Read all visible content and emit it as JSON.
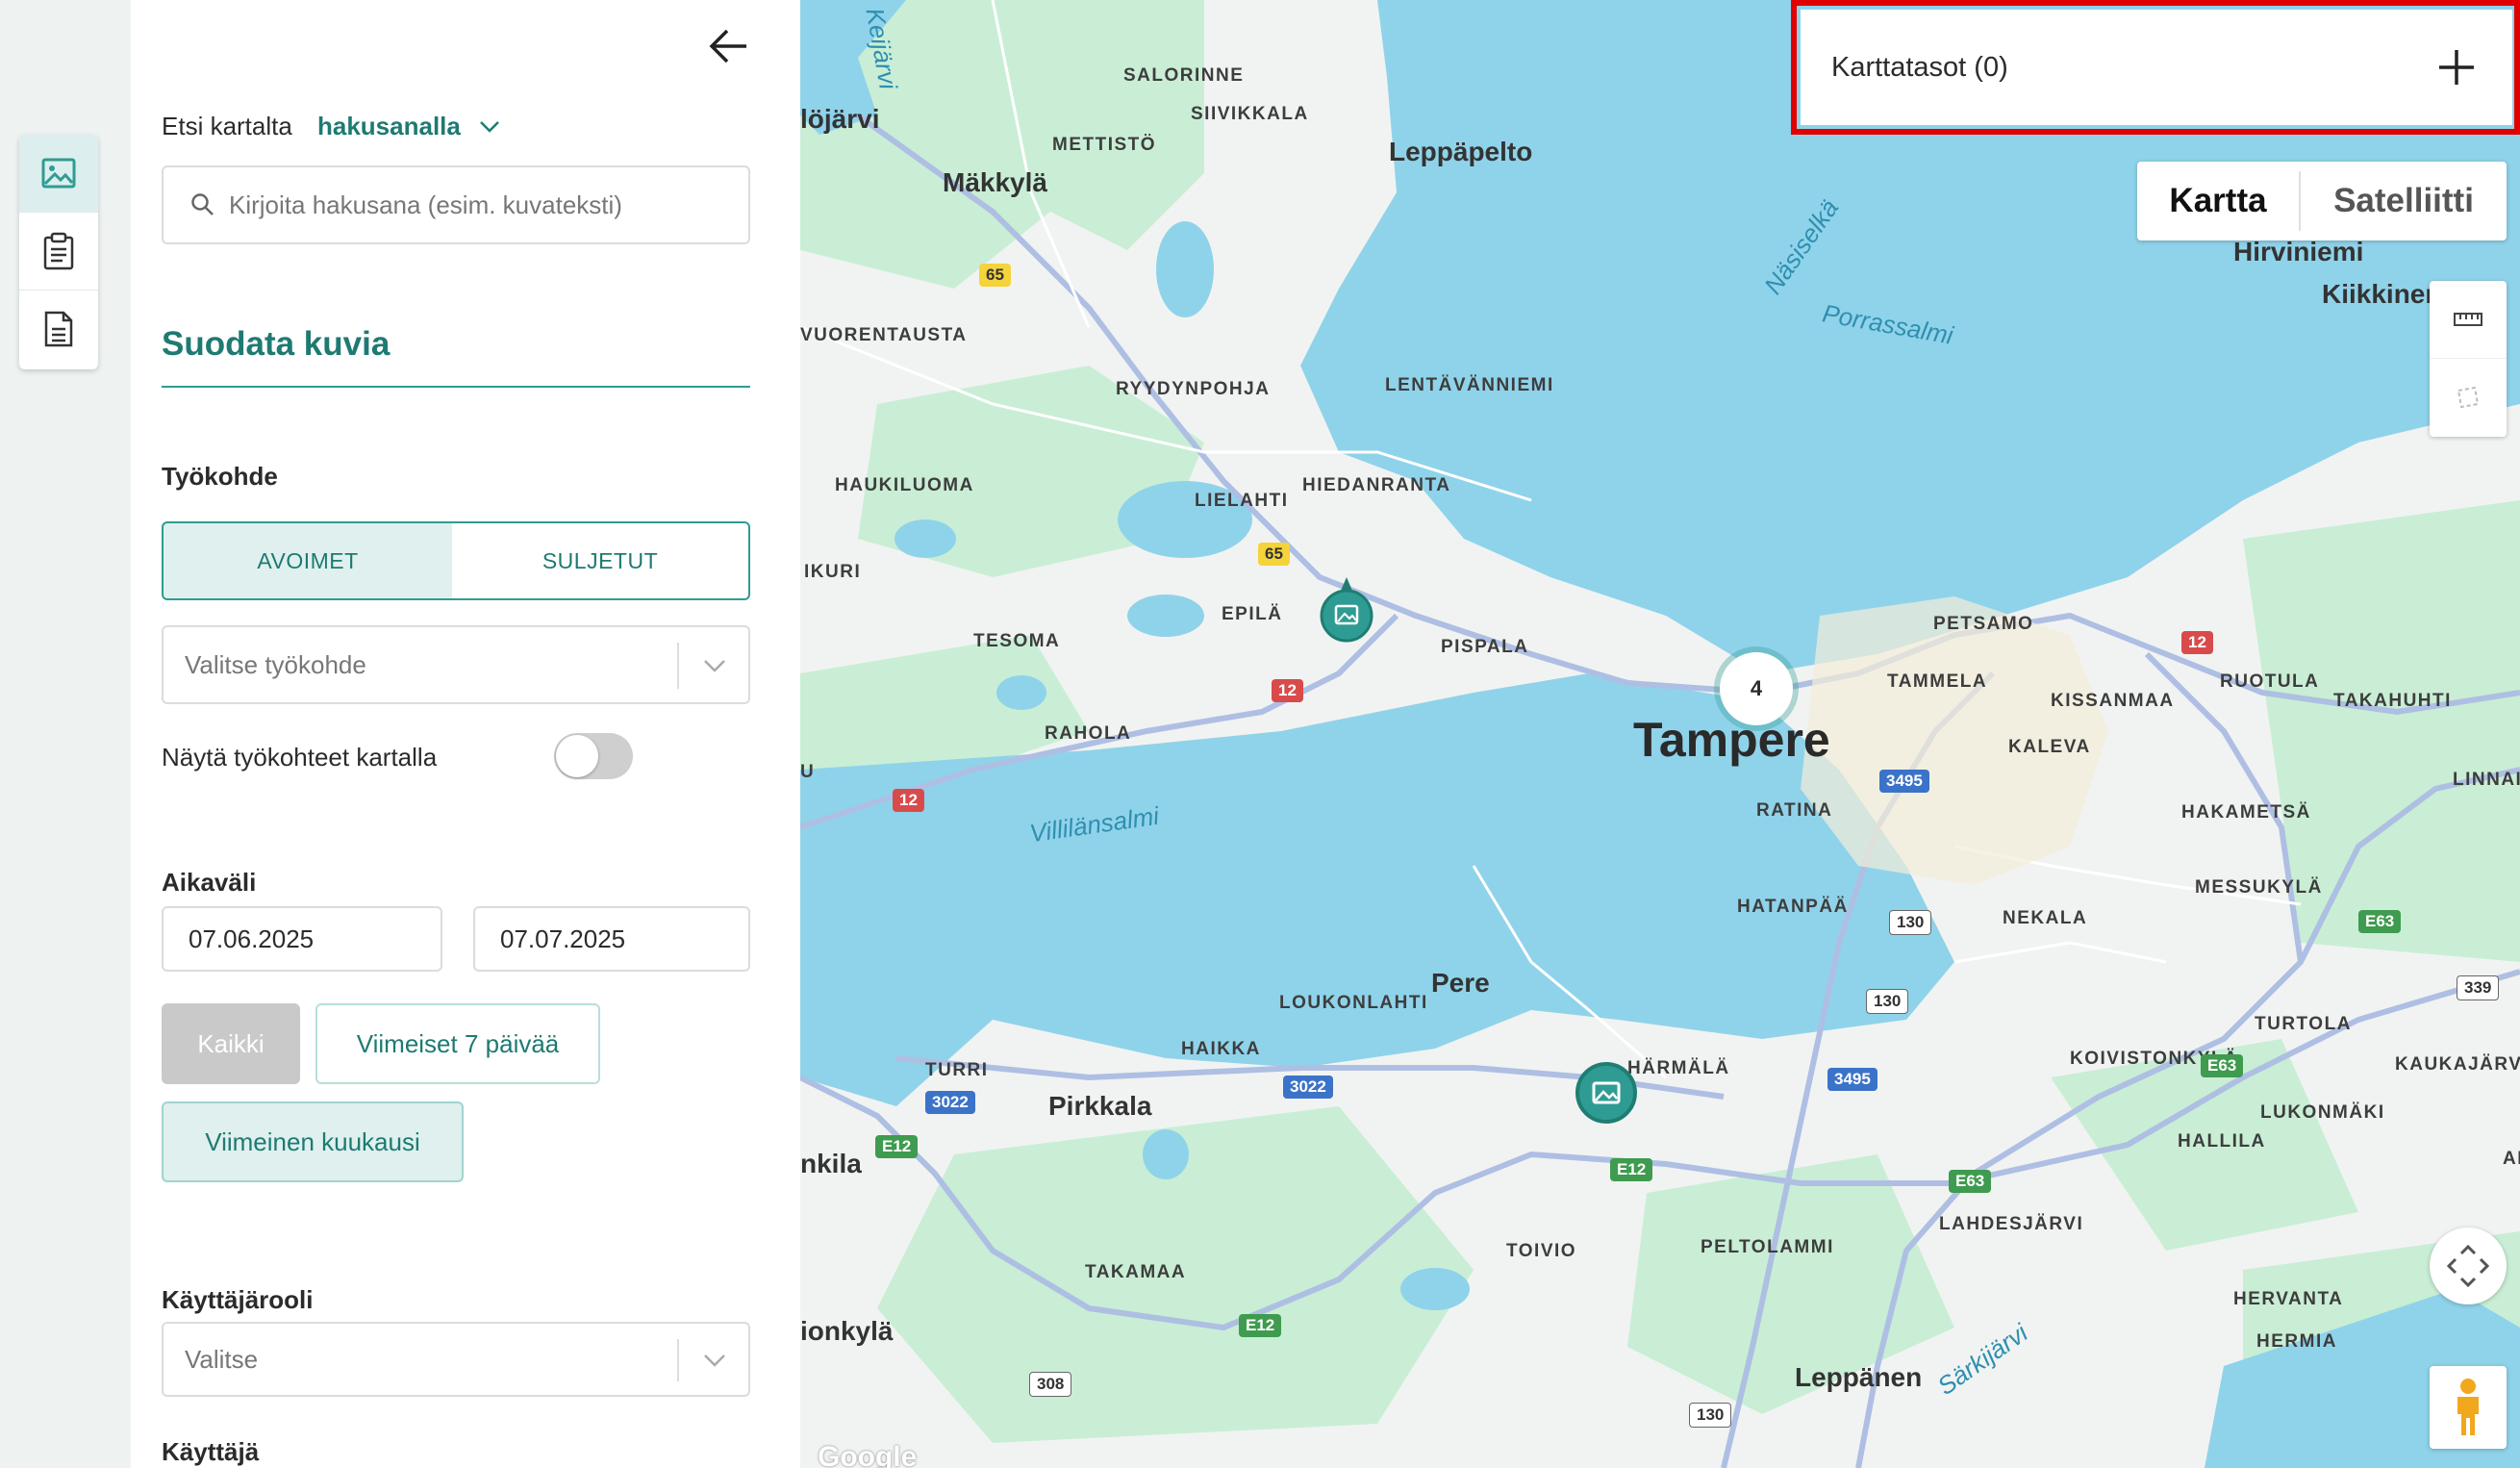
{
  "sidebar_icons": [
    "image-icon",
    "clipboard-icon",
    "document-icon"
  ],
  "panel": {
    "search_prefix": "Etsi kartalta",
    "search_mode": "hakusanalla",
    "search_placeholder": "Kirjoita hakusana (esim. kuvateksti)",
    "filter_title": "Suodata kuvia",
    "worksite": {
      "label": "Työkohde",
      "tab_open": "AVOIMET",
      "tab_closed": "SULJETUT",
      "select_placeholder": "Valitse työkohde",
      "toggle_label": "Näytä työkohteet kartalla",
      "toggle_on": false
    },
    "period": {
      "label": "Aikaväli",
      "start": "07.06.2025",
      "end": "07.07.2025",
      "btn_all": "Kaikki",
      "btn_7days": "Viimeiset 7 päivää",
      "btn_month": "Viimeinen kuukausi"
    },
    "role": {
      "label": "Käyttäjärooli",
      "placeholder": "Valitse"
    },
    "user": {
      "label": "Käyttäjä"
    }
  },
  "map": {
    "layers_label": "Karttatasot (0)",
    "type_map": "Kartta",
    "type_satellite": "Satelliitti",
    "cluster_count": "4",
    "city_label": "Tampere",
    "attribution": "Google",
    "colors": {
      "water": "#8fd3ea",
      "park": "#c9eed5",
      "accent": "#2f9c93",
      "highlight": "#e00000"
    },
    "labels": {
      "salorinne": "SALORINNE",
      "siivikkala": "SIIVIKKALA",
      "mettisto": "METTISTÖ",
      "makkyla": "Mäkkylä",
      "leppapelto": "Leppäpelto",
      "lojarvi": "löjärvi",
      "vuorentausta": "VUORENTAUSTA",
      "ryydynpohja": "RYYDYNPOHJA",
      "lentavanniemi": "LENTÄVÄNNIEMI",
      "haukiluoma": "HAUKILUOMA",
      "lielahti": "LIELAHTI",
      "hiedanranta": "HIEDANRANTA",
      "ikuri": "IKURI",
      "epila": "EPILÄ",
      "tesoma": "TESOMA",
      "pispala": "PISPALA",
      "rahola": "RAHOLA",
      "petsamo": "PETSAMO",
      "tammela": "TAMMELA",
      "kissanmaa": "KISSANMAA",
      "ruotula": "RUOTULA",
      "takahuhti": "TAKAHUHTI",
      "kaleva": "KALEVA",
      "ratina": "RATINA",
      "linnainmaa": "LINNAINM",
      "hakametsa": "HAKAMETSÄ",
      "messukyla": "MESSUKYLÄ",
      "hatanpaa": "HATANPÄÄ",
      "nekala": "NEKALA",
      "pere": "Pere",
      "loukonlahti": "LOUKONLAHTI",
      "haikka": "HAIKKA",
      "turri": "TURRI",
      "pirkkala": "Pirkkala",
      "harmala": "HÄRMÄLÄ",
      "koivistonkyla": "KOIVISTONKYLÄ",
      "turtola": "TURTOLA",
      "kaukajarvi": "KAUKAJÄRVI",
      "lukonmaki": "LUKONMÄKI",
      "hallila": "HALLILA",
      "nkila": "nkila",
      "lahdesjarvi": "LAHDESJÄRVI",
      "peltolammi": "PELTOLAMMI",
      "toivio": "TOIVIO",
      "takamaa": "TAKAMAA",
      "ionkyla": "ionkylä",
      "hervanta": "HERVANTA",
      "hermia": "HERMIA",
      "leppanen": "Leppänen",
      "hirviniemi": "Hirviniemi",
      "kiikkinen": "Kiikkinen",
      "an": "AN",
      "u": "U",
      "nasiselka": "Näsiselkä",
      "porrassalmi": "Porrassalmi",
      "villilansalmi": "Villilänsalmi",
      "sarkijarvi": "Särkijärvi",
      "keijarvi": "Keijärvi"
    },
    "shields": [
      "65",
      "65",
      "12",
      "12",
      "12",
      "3495",
      "3495",
      "130",
      "130",
      "3022",
      "3022",
      "E12",
      "E12",
      "E12",
      "E63",
      "E63",
      "E63",
      "339",
      "308",
      "130"
    ]
  }
}
